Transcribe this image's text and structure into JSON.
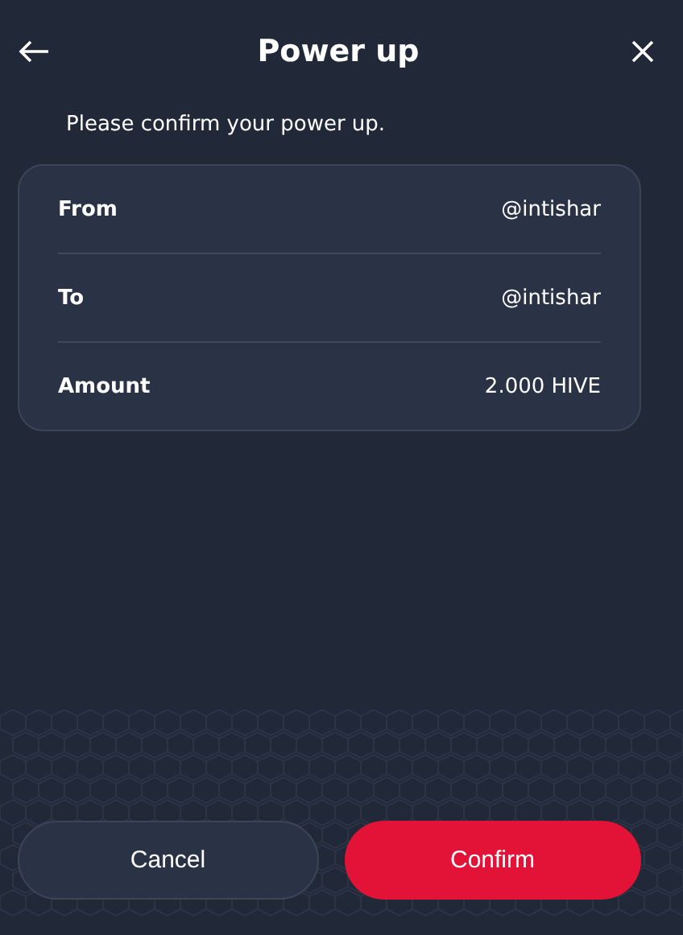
{
  "header": {
    "title": "Power up"
  },
  "subtitle": "Please confirm your power up.",
  "details": [
    {
      "label": "From",
      "value": "@intishar"
    },
    {
      "label": "To",
      "value": "@intishar"
    },
    {
      "label": "Amount",
      "value": "2.000 HIVE"
    }
  ],
  "buttons": [
    {
      "label": "Cancel",
      "kind": "secondary"
    },
    {
      "label": "Confirm",
      "kind": "primary"
    }
  ]
}
